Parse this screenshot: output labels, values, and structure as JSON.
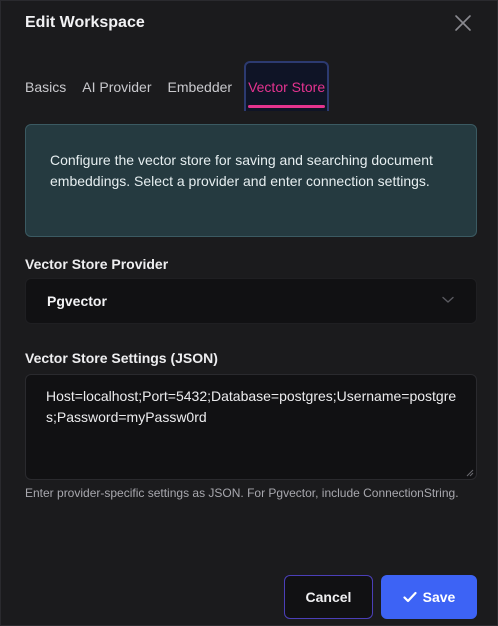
{
  "dialog": {
    "title": "Edit Workspace",
    "close_icon": "close-icon"
  },
  "tabs": [
    {
      "label": "Basics",
      "active": false
    },
    {
      "label": "AI Provider",
      "active": false
    },
    {
      "label": "Embedder",
      "active": false
    },
    {
      "label": "Vector Store",
      "active": true
    }
  ],
  "info": {
    "text": "Configure the vector store for saving and searching document embeddings. Select a provider and enter connection settings."
  },
  "provider": {
    "label": "Vector Store Provider",
    "selected": "Pgvector",
    "icon": "chevron-down-icon"
  },
  "settings": {
    "label": "Vector Store Settings (JSON)",
    "value": "Host=localhost;Port=5432;Database=postgres;Username=postgres;Password=myPassw0rd",
    "help": "Enter provider-specific settings as JSON. For Pgvector, include ConnectionString."
  },
  "actions": {
    "cancel_label": "Cancel",
    "save_label": "Save",
    "save_icon": "check-icon"
  },
  "colors": {
    "accent_pink": "#e4338f",
    "primary_blue": "#3d63f5",
    "info_bg": "#253a40",
    "cancel_border": "#4b3fb8"
  }
}
